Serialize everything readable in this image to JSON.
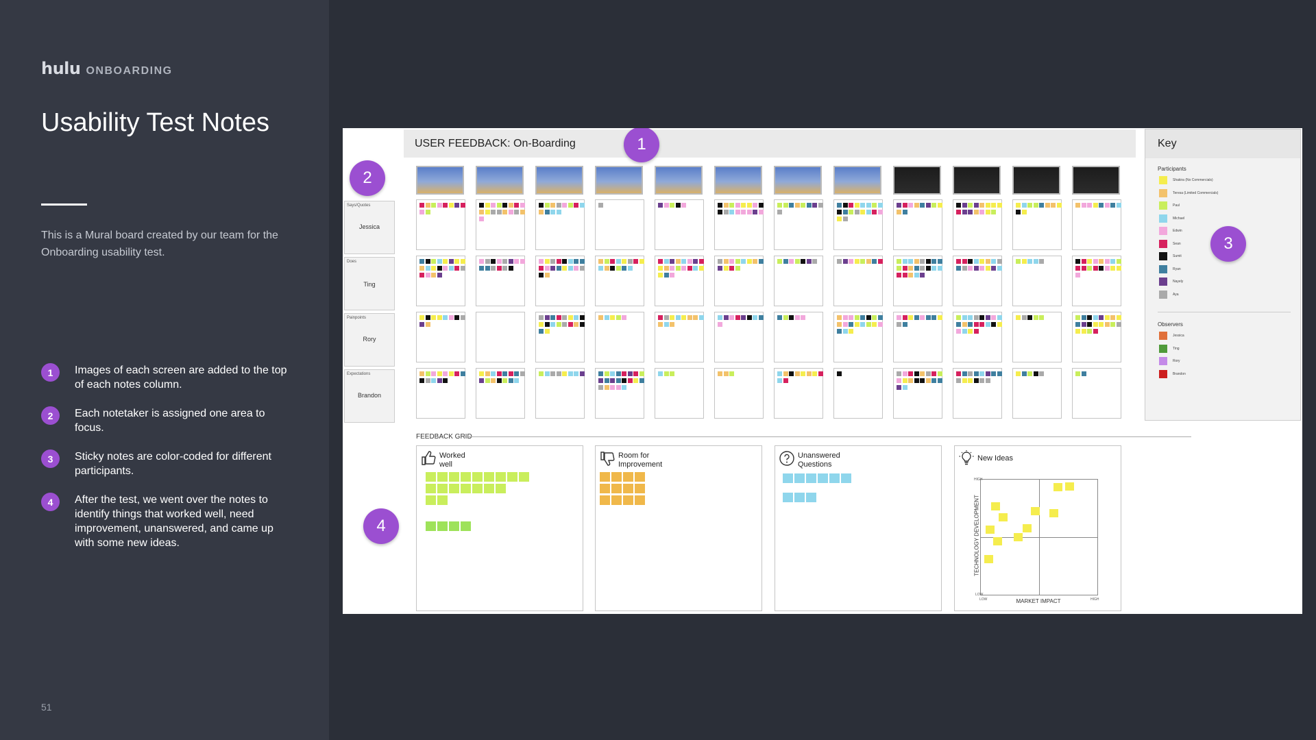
{
  "slide": {
    "brand_logo": "hulu",
    "brand_section": "ONBOARDING",
    "title": "Usability Test Notes",
    "description": "This is a Mural board created by our team for the Onboarding usability test.",
    "steps": [
      {
        "num": "1",
        "text": "Images of each screen are added to the top of each notes column."
      },
      {
        "num": "2",
        "text": "Each notetaker is assigned one area to focus."
      },
      {
        "num": "3",
        "text": "Sticky notes are color-coded for different participants."
      },
      {
        "num": "4",
        "text": "After the test, we went over the notes to identify things that worked well, need improvement, unanswered, and came up with some new ideas."
      }
    ],
    "page_number": "51",
    "accent_color": "#9b4fd1"
  },
  "board": {
    "header": "USER FEEDBACK: On-Boarding",
    "badges": [
      "1",
      "2",
      "3",
      "4"
    ],
    "rows": [
      {
        "category": "Says/Quotes",
        "notetaker": "Jessica"
      },
      {
        "category": "Does",
        "notetaker": "Ting"
      },
      {
        "category": "Painpoints",
        "notetaker": "Rory"
      },
      {
        "category": "Expectations",
        "notetaker": "Brandon"
      }
    ],
    "screen_thumbnails": [
      "light",
      "light",
      "light",
      "light",
      "light",
      "light",
      "light",
      "light",
      "dark",
      "dark",
      "dark",
      "dark"
    ],
    "feedback_grid": {
      "label": "FEEDBACK GRID",
      "worked_well": "Worked\nwell",
      "room": "Room for\nImprovement",
      "unanswered": "Unanswered\nQuestions",
      "new_ideas": "New Ideas",
      "x_axis": "MARKET IMPACT",
      "y_axis": "TECHNOLOGY DEVELOPMENT",
      "x_low": "LOW",
      "x_high": "HIGH",
      "y_high": "HIGH",
      "y_low": "LOW"
    },
    "key": {
      "title": "Key",
      "participants_label": "Participants",
      "participants": [
        {
          "name": "Shakira (No Commercials)",
          "color": "#f5ed4e"
        },
        {
          "name": "Teresa (Limited Commercials)",
          "color": "#f3c26b"
        },
        {
          "name": "Paul",
          "color": "#c9ee5c"
        },
        {
          "name": "Michael",
          "color": "#8fd6ec"
        },
        {
          "name": "Edwin",
          "color": "#f2a8dc"
        },
        {
          "name": "Sean",
          "color": "#d6215e"
        },
        {
          "name": "Sumit",
          "color": "#111111"
        },
        {
          "name": "Ryan",
          "color": "#3f7f9f"
        },
        {
          "name": "Nayely",
          "color": "#6b3f8e"
        },
        {
          "name": "Aya",
          "color": "#aaaaaa"
        }
      ],
      "observers_label": "Observers",
      "observers": [
        {
          "name": "Jessica",
          "color": "#e0703a"
        },
        {
          "name": "Ting",
          "color": "#4f9a3a"
        },
        {
          "name": "Rory",
          "color": "#c48ae8"
        },
        {
          "name": "Brandon",
          "color": "#cc1f1f"
        }
      ]
    }
  }
}
